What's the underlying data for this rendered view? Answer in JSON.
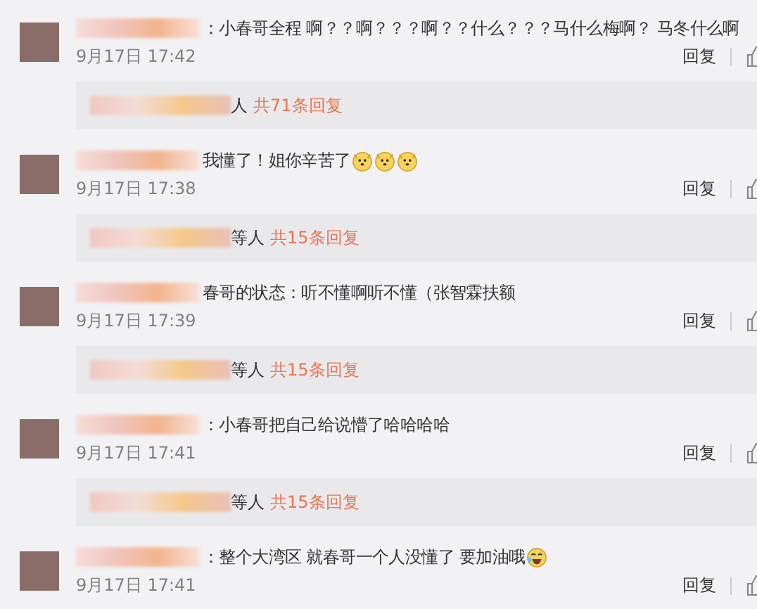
{
  "comments": [
    {
      "text": "：小春哥全程 啊？？啊？？？啊？？什么？？？马什么梅啊？ 马冬什么啊",
      "time": "9月17日 17:42",
      "reply_label": "回复",
      "replies": {
        "suffix": "人",
        "count": "共71条回复"
      }
    },
    {
      "text": "我懂了！姐你辛苦了",
      "emojis": [
        {
          "kind": "doge"
        },
        {
          "kind": "doge"
        },
        {
          "kind": "doge"
        }
      ],
      "time": "9月17日 17:38",
      "reply_label": "回复",
      "replies": {
        "suffix": "等人",
        "count": "共15条回复"
      }
    },
    {
      "text": "春哥的状态：听不懂啊听不懂（张智霖扶额",
      "time": "9月17日 17:39",
      "reply_label": "回复",
      "replies": {
        "suffix": "等人",
        "count": "共15条回复"
      }
    },
    {
      "text": "：小春哥把自己给说懵了哈哈哈哈",
      "time": "9月17日 17:41",
      "reply_label": "回复",
      "replies": {
        "suffix": "等人",
        "count": "共15条回复"
      }
    },
    {
      "text": "：整个大湾区 就春哥一个人没懂了  要加油哦",
      "emojis": [
        {
          "kind": "laugh-cry"
        }
      ],
      "time": "9月17日 17:41",
      "reply_label": "回复"
    }
  ]
}
